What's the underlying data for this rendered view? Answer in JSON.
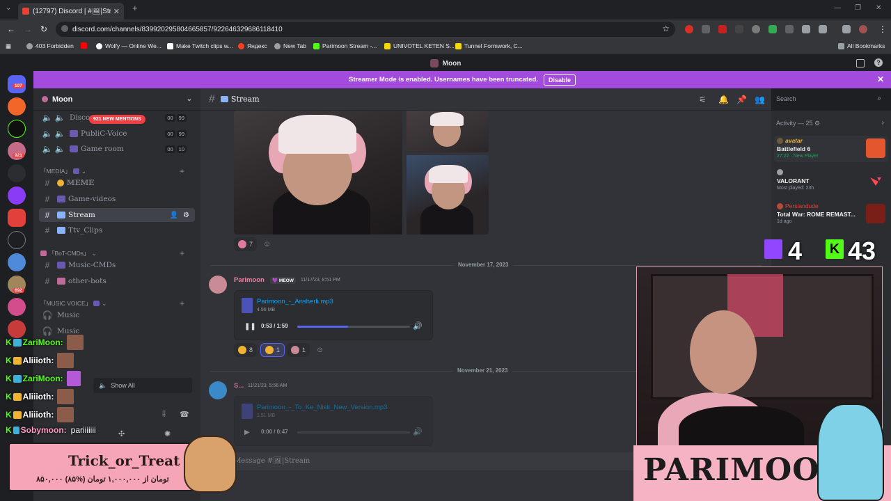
{
  "browser": {
    "tab_title": "(12797) Discord | #🖼|Str",
    "url": "discord.com/channels/839920295804665857/922646329686118410",
    "bookmarks": [
      "403 Forbidden",
      "Wolfy — Online We...",
      "Make Twitch clips w...",
      "Яндекс",
      "New Tab",
      "Parimoon Stream -...",
      "UNIVOTEL KETEN S...",
      "Tunnel Formwork, C..."
    ],
    "all_bookmarks": "All Bookmarks"
  },
  "discord": {
    "window_title": "Moon",
    "streamer_banner": "Streamer Mode is enabled. Usernames have been truncated.",
    "disable_label": "Disable",
    "server_name": "Moon",
    "new_mentions": "921 NEW MENTIONS",
    "channels": {
      "voice1": "Discor",
      "voice1_counts": [
        "00",
        "99"
      ],
      "voice2": "PubliC-Voice",
      "voice2_counts": [
        "00",
        "99"
      ],
      "voice3": "Game room",
      "voice3_counts": [
        "00",
        "10"
      ],
      "cat_media": "「MEDIA」",
      "meme": "𝕄𝔼𝕄𝔼",
      "game_videos": "Game-videos",
      "stream": "Stream",
      "ttv": "Ttv_Clips",
      "cat_bot": "「BoT-CMDs」",
      "music_cmds": "Music-CMDs",
      "other_bots": "other-bots",
      "cat_music": "「MUSIC VOICE」",
      "music1": "Music",
      "music2": "Music",
      "show_all": "Show All"
    },
    "channel_header": "Stream",
    "search_placeholder": "Search",
    "reaction1_count": "7",
    "date1": "November 17, 2023",
    "msg1": {
      "author": "Parimoon",
      "tag": "MEOW",
      "time": "11/17/23, 8:51 PM",
      "file": "Parimoon_-_Ansherli.mp3",
      "size": "4.56 MB",
      "playtime": "0:53 / 1:59",
      "progress": 0.45
    },
    "msg1_reactions": [
      "8",
      "1",
      "1"
    ],
    "date2": "November 21, 2023",
    "msg2": {
      "author": "S...",
      "time": "11/21/23, 5:56 AM",
      "file": "Parimoon_-_To_Ke_Nisti_New_Version.mp3",
      "size": "1.51 MB",
      "playtime": "0:00 / 0:47"
    },
    "message_placeholder": "Message #🖼|Stream",
    "activity_header": "Activity — 25",
    "activities": [
      {
        "user": "avatar",
        "game": "Battlefield 6",
        "status": "27:22 · New Player"
      },
      {
        "user": "",
        "game": "VALORANT",
        "status": "Most played: 23h"
      },
      {
        "user": "Persiandude",
        "game": "Total War: ROME REMAST...",
        "status": "1d ago"
      }
    ]
  },
  "overlay": {
    "chat": [
      {
        "user": "ZariMoon:",
        "badge": "K"
      },
      {
        "user": "Aliiioth:",
        "badge": "K"
      },
      {
        "user": "ZariMoon:",
        "badge": "K"
      },
      {
        "user": "Aliiioth:",
        "badge": "K"
      },
      {
        "user": "Aliiioth:",
        "badge": "K"
      },
      {
        "user": "Sobymoon:",
        "badge": "K",
        "text": "pariiiiiii"
      }
    ],
    "trick_title": "Trick_or_Treat",
    "trick_price": "۸۵۰,۰۰۰ تومان از ۱,۰۰۰,۰۰۰ تومان (%۸۵)",
    "twitch_count": "4",
    "kick_count": "43",
    "brand": "PARIMOON"
  },
  "colors": {
    "streamer_banner": "#a34bdc",
    "username_pink": "#f47fa3",
    "kick_green": "#53fc18"
  }
}
